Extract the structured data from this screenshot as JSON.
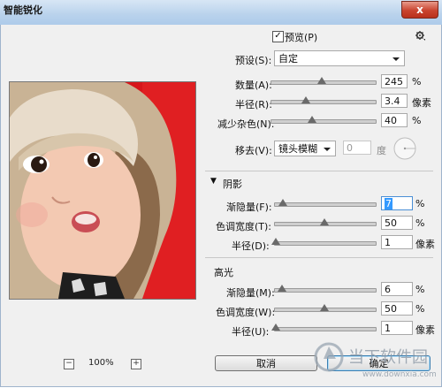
{
  "window": {
    "title": "智能锐化",
    "close_glyph": "x"
  },
  "preview_checkbox": {
    "checked": true,
    "label": "预览(P)"
  },
  "settings_icon": "gear-icon",
  "preset": {
    "label": "预设(S):",
    "value": "自定"
  },
  "sharpen": [
    {
      "label": "数量(A):",
      "value": "245",
      "unit": "%",
      "level": 0.49
    },
    {
      "label": "半径(R):",
      "value": "3.4",
      "unit": "像素",
      "level": 0.34
    },
    {
      "label": "减少杂色(N):",
      "value": "40",
      "unit": "%",
      "level": 0.4
    }
  ],
  "remove": {
    "label": "移去(V):",
    "value": "镜头模糊",
    "angle_value": "0",
    "angle_unit": "度"
  },
  "shadows": {
    "header": "阴影",
    "rows": [
      {
        "label": "渐隐量(F):",
        "value": "7",
        "unit": "%",
        "level": 0.07,
        "highlighted": true
      },
      {
        "label": "色调宽度(T):",
        "value": "50",
        "unit": "%",
        "level": 0.5
      },
      {
        "label": "半径(D):",
        "value": "1",
        "unit": "像素",
        "level": 0.0
      }
    ]
  },
  "highlights": {
    "header": "高光",
    "rows": [
      {
        "label": "渐隐量(M):",
        "value": "6",
        "unit": "%",
        "level": 0.06
      },
      {
        "label": "色调宽度(W):",
        "value": "50",
        "unit": "%",
        "level": 0.5
      },
      {
        "label": "半径(U):",
        "value": "1",
        "unit": "像素",
        "level": 0.0
      }
    ]
  },
  "zoom": {
    "minus": "−",
    "plus": "+",
    "level": "100%"
  },
  "buttons": {
    "cancel": "取消",
    "ok": "确定"
  },
  "watermark": {
    "text": "当下软件园",
    "url": "www.downxia.com"
  }
}
